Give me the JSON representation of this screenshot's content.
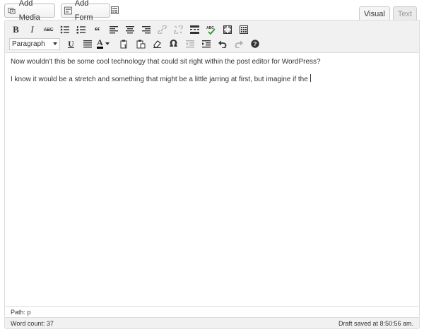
{
  "media": {
    "add_media": "Add Media",
    "add_form": "Add Form"
  },
  "tabs": {
    "visual": "Visual",
    "text": "Text"
  },
  "toolbar": {
    "strike_label": "ABC",
    "format_select": "Paragraph",
    "omega": "Ω",
    "color_letter": "A"
  },
  "content": {
    "p1": "Now wouldn't this be some cool technology that could sit right within the post editor for WordPress?",
    "p2": "I know it would be a stretch and something that might be a little jarring at first, but imagine if the"
  },
  "status": {
    "path": "Path: p",
    "word_count": "Word count: 37",
    "draft_saved": "Draft saved at 8:50:56 am."
  },
  "colors": {
    "toolbar_bg": "#f1f1f1",
    "border": "#dddddd",
    "text": "#333333"
  }
}
